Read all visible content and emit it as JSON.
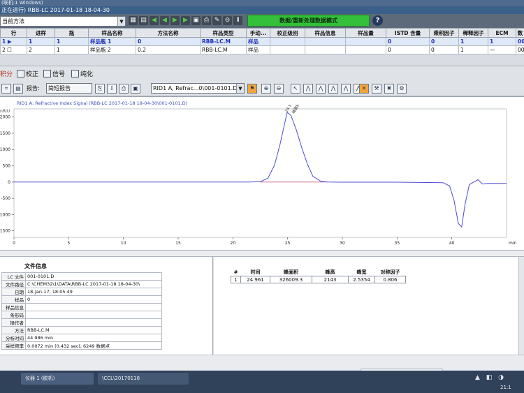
{
  "window": {
    "title": "(联机:1 Windows)",
    "sequence_title": "正在进行) RBB-LC 2017-01-18 18-04-30"
  },
  "toolbar": {
    "method_combo": "当前方法",
    "mode_label": "数据/重新处理数据模式",
    "help": "?"
  },
  "sequence_table": {
    "columns": [
      "行",
      "进样",
      "瓶",
      "样品名称",
      "方法名称",
      "样品类型",
      "手动...",
      "校正级别",
      "样品信息",
      "样品量",
      "ISTD 含量",
      "乘积因子",
      "稀释因子",
      "ECM",
      "数"
    ],
    "rows": [
      {
        "mark": "1 ▶",
        "line": "1",
        "inj": "1",
        "vial": "样品瓶 1",
        "sample": "0",
        "method": "RBB-LC.M",
        "type": "样品",
        "manual": "",
        "cal": "",
        "info": "",
        "amount": "0",
        "istd": "0",
        "mult": "1",
        "dil": "1",
        "ecm": "",
        "data": "00"
      },
      {
        "mark": "2 ☐",
        "line": "2",
        "inj": "1",
        "vial": "样品瓶 2",
        "sample": "0.2",
        "method": "RBB-LC.M",
        "type": "样品",
        "manual": "",
        "cal": "",
        "info": "",
        "amount": "0",
        "istd": "0",
        "mult": "1",
        "dil": "1",
        "ecm": "—",
        "data": "00"
      }
    ]
  },
  "view_bar": {
    "items": [
      "积分",
      "校正",
      "信号",
      "纯化"
    ]
  },
  "report_bar": {
    "report_label": "报告:",
    "report_combo": "简短报告",
    "signal_combo": "RID1 A, Refrac...0\\001-0101.D)"
  },
  "chart_data": {
    "type": "line",
    "title": "RID1 A, Refractive Index Signal (RBB-LC 2017-01-18 18-04-30\\001-0101.D)",
    "ylabel": "nRIU",
    "xlabel": "min",
    "xlim": [
      0,
      45
    ],
    "ylim": [
      -1700,
      2250
    ],
    "x_ticks": [
      0,
      5,
      10,
      15,
      20,
      25,
      30,
      35,
      40
    ],
    "y_ticks": [
      2000,
      1500,
      1000,
      500,
      0,
      -500,
      -1000,
      -1500
    ],
    "y_tick_labels": [
      "2000",
      "1500",
      "1000",
      "500",
      "0",
      "-500",
      "-1000",
      "-1500"
    ],
    "series": [
      {
        "color": "#4b4bd6",
        "x": [
          0,
          10,
          20,
          21.5,
          22.5,
          23.2,
          23.8,
          24.3,
          24.7,
          24.96,
          25.3,
          25.8,
          26.3,
          26.8,
          27.3,
          28.0,
          28.6,
          30,
          35,
          39.2,
          39.8,
          40.2,
          40.6,
          40.9,
          41.2,
          41.6,
          42.0,
          42.4,
          42.8,
          43.3,
          45
        ],
        "y": [
          0,
          0,
          0,
          0,
          10,
          120,
          520,
          1150,
          1760,
          2143,
          2050,
          1600,
          1050,
          560,
          180,
          30,
          0,
          -5,
          -5,
          -20,
          -120,
          -560,
          -1280,
          -1380,
          -700,
          -80,
          0,
          70,
          -60,
          -40,
          -40
        ]
      }
    ],
    "baseline": {
      "color": "#d06a8e",
      "x": [
        22.5,
        28.6
      ],
      "y": [
        0,
        0
      ]
    },
    "annotations": [
      {
        "x": 24.96,
        "y": 2143,
        "text": "24.961"
      },
      {
        "x": 25.6,
        "y": 2100,
        "text": "峰面积: 326009"
      }
    ]
  },
  "file_info": {
    "header": "文件信息",
    "rows": [
      {
        "key": "LC 文件",
        "value": "001-0101.D"
      },
      {
        "key": "文件路径",
        "value": "C:\\CHEM32\\1\\DATA\\RBB-LC 2017-01-18 18-04-30\\"
      },
      {
        "key": "日期",
        "value": "18-Jan-17, 18:05:49"
      },
      {
        "key": "样品",
        "value": "0"
      },
      {
        "key": "样品信息",
        "value": ""
      },
      {
        "key": "条形码",
        "value": ""
      },
      {
        "key": "操作者",
        "value": ""
      },
      {
        "key": "方法",
        "value": "RBB-LC.M"
      },
      {
        "key": "分析时间",
        "value": "44.986 min"
      },
      {
        "key": "采样频率",
        "value": "0.0072 min (0.432 sec), 6249 数据点"
      }
    ]
  },
  "peak_table": {
    "headers": [
      "#",
      "时间",
      "峰面积",
      "峰高",
      "峰宽",
      "对称因子"
    ],
    "rows": [
      [
        "1",
        "24.961",
        "326009.3",
        "2143",
        "2.5354",
        "0.806"
      ]
    ]
  },
  "taskbar": {
    "items": [
      "仪器 1 (脱机)",
      "\\CCL\\20170118"
    ],
    "clock": "21:1",
    "tray_glyph": "S"
  }
}
